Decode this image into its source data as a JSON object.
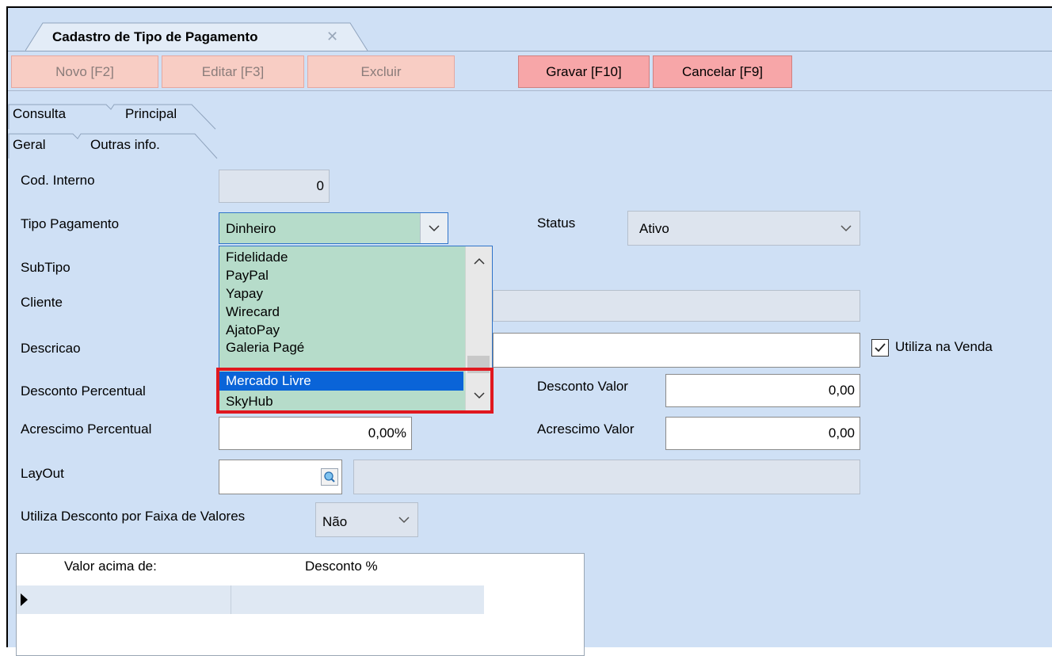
{
  "window": {
    "tab_title": "Cadastro de Tipo de Pagamento",
    "tab_close": "✕"
  },
  "toolbar": {
    "novo": "Novo [F2]",
    "editar": "Editar [F3]",
    "excluir": "Excluir",
    "gravar": "Gravar [F10]",
    "cancelar": "Cancelar [F9]"
  },
  "tabs": {
    "consulta": "Consulta",
    "principal": "Principal",
    "geral": "Geral",
    "outras": "Outras info."
  },
  "form": {
    "cod_interno_label": "Cod. Interno",
    "cod_interno_value": "0",
    "tipo_pagamento_label": "Tipo  Pagamento",
    "tipo_pagamento_value": "Dinheiro",
    "status_label": "Status",
    "status_value": "Ativo",
    "subtipo_label": "SubTipo",
    "cliente_label": "Cliente",
    "descricao_label": "Descricao",
    "utiliza_venda_label": "Utiliza na Venda",
    "desconto_percentual_label": "Desconto Percentual",
    "desconto_valor_label": "Desconto Valor",
    "desconto_valor_value": "0,00",
    "acrescimo_percentual_label": "Acrescimo Percentual",
    "acrescimo_percentual_value": "0,00%",
    "acrescimo_valor_label": "Acrescimo Valor",
    "acrescimo_valor_value": "0,00",
    "layout_label": "LayOut",
    "faixa_label": "Utiliza Desconto por Faixa de Valores",
    "faixa_value": "Não"
  },
  "dropdown": {
    "items": [
      "Fidelidade",
      "PayPal",
      "Yapay",
      "Wirecard",
      "AjatoPay",
      "Galeria Pagé",
      "Mercado Livre",
      "SkyHub"
    ],
    "selected": "Mercado Livre"
  },
  "grid": {
    "columns": [
      "Valor acima de:",
      "Desconto %"
    ]
  }
}
